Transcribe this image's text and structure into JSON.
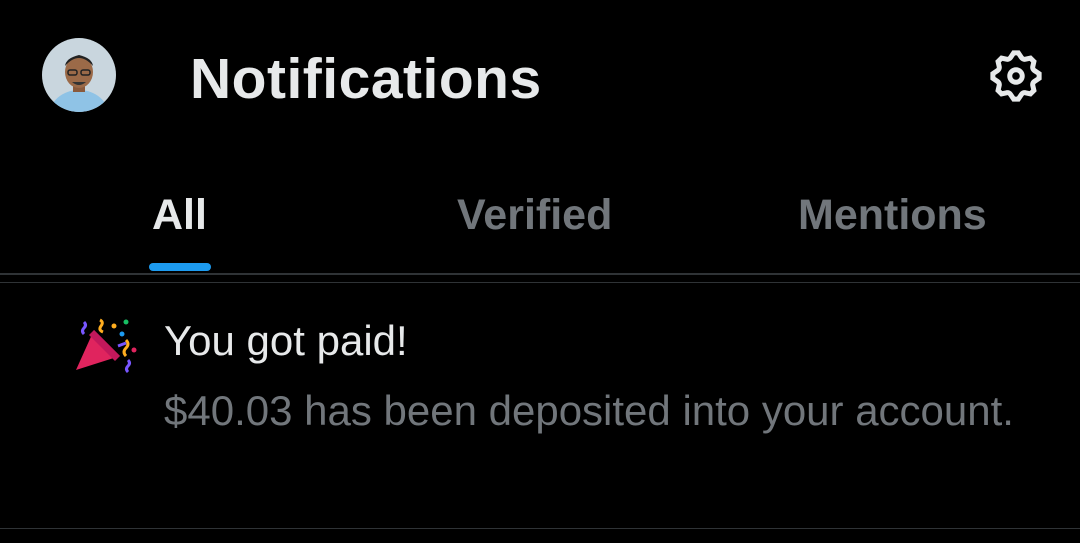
{
  "header": {
    "title": "Notifications",
    "avatar_icon": "user-avatar",
    "settings_icon": "gear-icon"
  },
  "tabs": [
    {
      "label": "All",
      "active": true
    },
    {
      "label": "Verified",
      "active": false
    },
    {
      "label": "Mentions",
      "active": false
    }
  ],
  "notification": {
    "icon": "party-popper-icon",
    "title": "You got paid!",
    "body": "$40.03 has been deposited into your account."
  },
  "colors": {
    "background": "#000000",
    "primary_text": "#e7e9ea",
    "secondary_text": "#71767b",
    "accent": "#1d9bf0",
    "divider": "#2f3336"
  }
}
